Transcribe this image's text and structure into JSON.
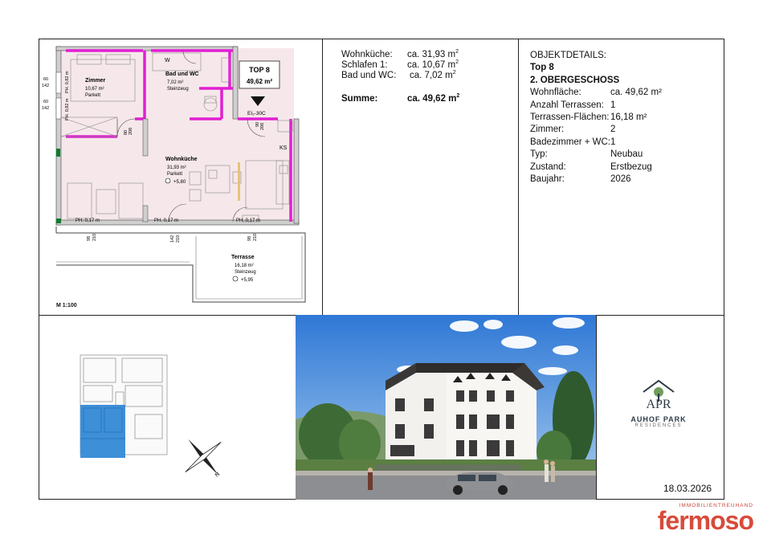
{
  "scale": "M 1:100",
  "plan": {
    "rooms": {
      "zimmer": {
        "name": "Zimmer",
        "area": "10,67 m²",
        "floor": "Parkett"
      },
      "bad": {
        "name": "Bad und WC",
        "area": "7,02 m²",
        "floor": "Steinzeug"
      },
      "kueche": {
        "name": "Wohnküche",
        "area": "31,93 m²",
        "floor": "Parkett",
        "level": "+5,80"
      },
      "terrasse": {
        "name": "Terrasse",
        "area": "16,18 m²",
        "floor": "Steinzeug",
        "level": "+5,95"
      }
    },
    "top_label": "TOP 8",
    "top_area": "49,62 m²",
    "eingang": "EI₂-30C",
    "ks": "KS",
    "w": "W",
    "ph_labels": [
      "PH. 0,17 m",
      "PH. 0,17 m",
      "PH. 0,17 m"
    ],
    "left_dims": [
      "60",
      "142",
      "60",
      "142"
    ],
    "left_vert": [
      "PH. 0,82 m",
      "PH. 0,82 m"
    ],
    "door_dims": [
      "80",
      "206",
      "90",
      "206"
    ],
    "bottom_dims": [
      "98",
      "210",
      "142",
      "210",
      "98",
      "210"
    ]
  },
  "areas": {
    "rows": [
      {
        "label": "Wohnküche:",
        "value": "ca. 31,93 m",
        "sup": "2"
      },
      {
        "label": "Schlafen 1:",
        "value": "ca. 10,67 m",
        "sup": "2"
      },
      {
        "label": "Bad und WC:",
        "value": "ca.  7,02 m",
        "sup": "2"
      }
    ],
    "sum_label": "Summe:",
    "sum_value": "ca.  49,62 m",
    "sum_sup": "2"
  },
  "details": {
    "heading": "OBJEKTDETAILS:",
    "top": "Top 8",
    "floor": "2. OBERGESCHOSS",
    "rows": [
      {
        "label": "Wohnfläche:",
        "value": "ca. 49,62 m²"
      },
      {
        "label": "Anzahl Terrassen:",
        "value": "1"
      },
      {
        "label": "Terrassen-Flächen:",
        "value": "16,18 m²"
      },
      {
        "label": "Zimmer:",
        "value": "2"
      },
      {
        "label": "Badezimmer + WC:",
        "value": "1"
      },
      {
        "label": "Typ:",
        "value": "Neubau"
      },
      {
        "label": "Zustand:",
        "value": "Erstbezug"
      },
      {
        "label": "Baujahr:",
        "value": "2026"
      }
    ]
  },
  "compass_letter": "N",
  "logo": {
    "mark": "APR",
    "name": "AUHOF PARK",
    "tagline": "RESIDENCES"
  },
  "date": "18.03.2026",
  "brand": {
    "sub": "IMMOBILIENTREUHAND",
    "name": "fermoso"
  },
  "colors": {
    "magenta": "#e21fd3",
    "plan_fill": "#f6e8ea",
    "blue": "#3d8fd8",
    "brand": "#d94a3a"
  }
}
